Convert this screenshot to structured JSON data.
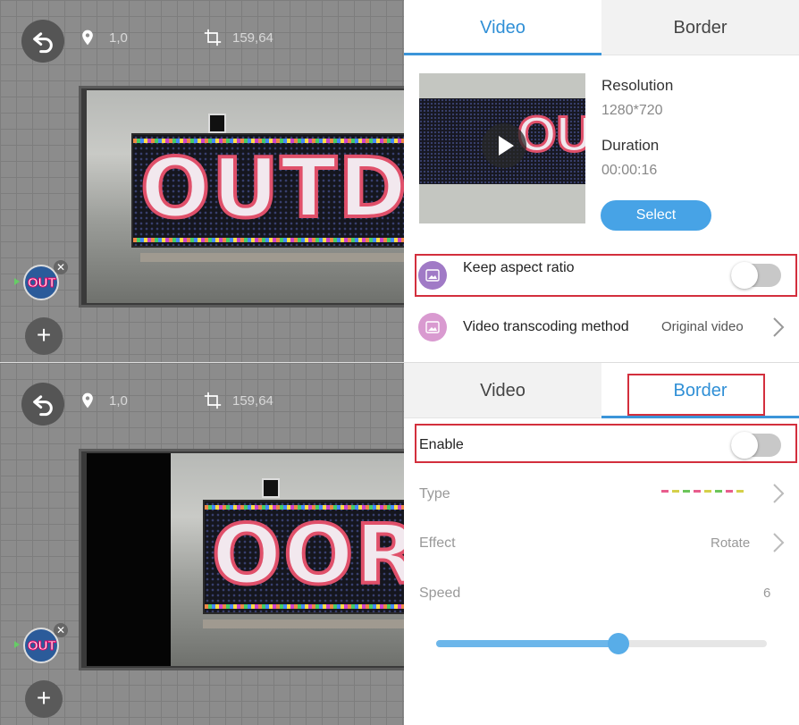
{
  "top": {
    "canvas": {
      "position": "1,0",
      "size": "159,64",
      "led_text": "OUTD",
      "thumb_text": "OUT"
    },
    "tabs": [
      {
        "label": "Video",
        "active": true
      },
      {
        "label": "Border",
        "active": false
      }
    ],
    "video": {
      "thumb_text": "OU",
      "resolution_label": "Resolution",
      "resolution_value": "1280*720",
      "duration_label": "Duration",
      "duration_value": "00:00:16",
      "select_label": "Select"
    },
    "keep_aspect": {
      "label": "Keep aspect ratio",
      "enabled": false,
      "icon": "image-icon"
    },
    "transcoding": {
      "label": "Video transcoding method",
      "value": "Original video",
      "icon": "image-icon"
    }
  },
  "bottom": {
    "canvas": {
      "position": "1,0",
      "size": "159,64",
      "led_text": "OOR",
      "thumb_text": "OUT"
    },
    "tabs": [
      {
        "label": "Video",
        "active": false
      },
      {
        "label": "Border",
        "active": true
      }
    ],
    "enable": {
      "label": "Enable",
      "enabled": false
    },
    "type": {
      "label": "Type"
    },
    "effect": {
      "label": "Effect",
      "value": "Rotate"
    },
    "speed": {
      "label": "Speed",
      "value": "6",
      "fraction": 0.55
    }
  },
  "colors": {
    "accent": "#3b95d9",
    "highlight": "#d32f3d",
    "icon_bg": "#a07ac6",
    "icon_bg_light": "#d99ad0"
  }
}
